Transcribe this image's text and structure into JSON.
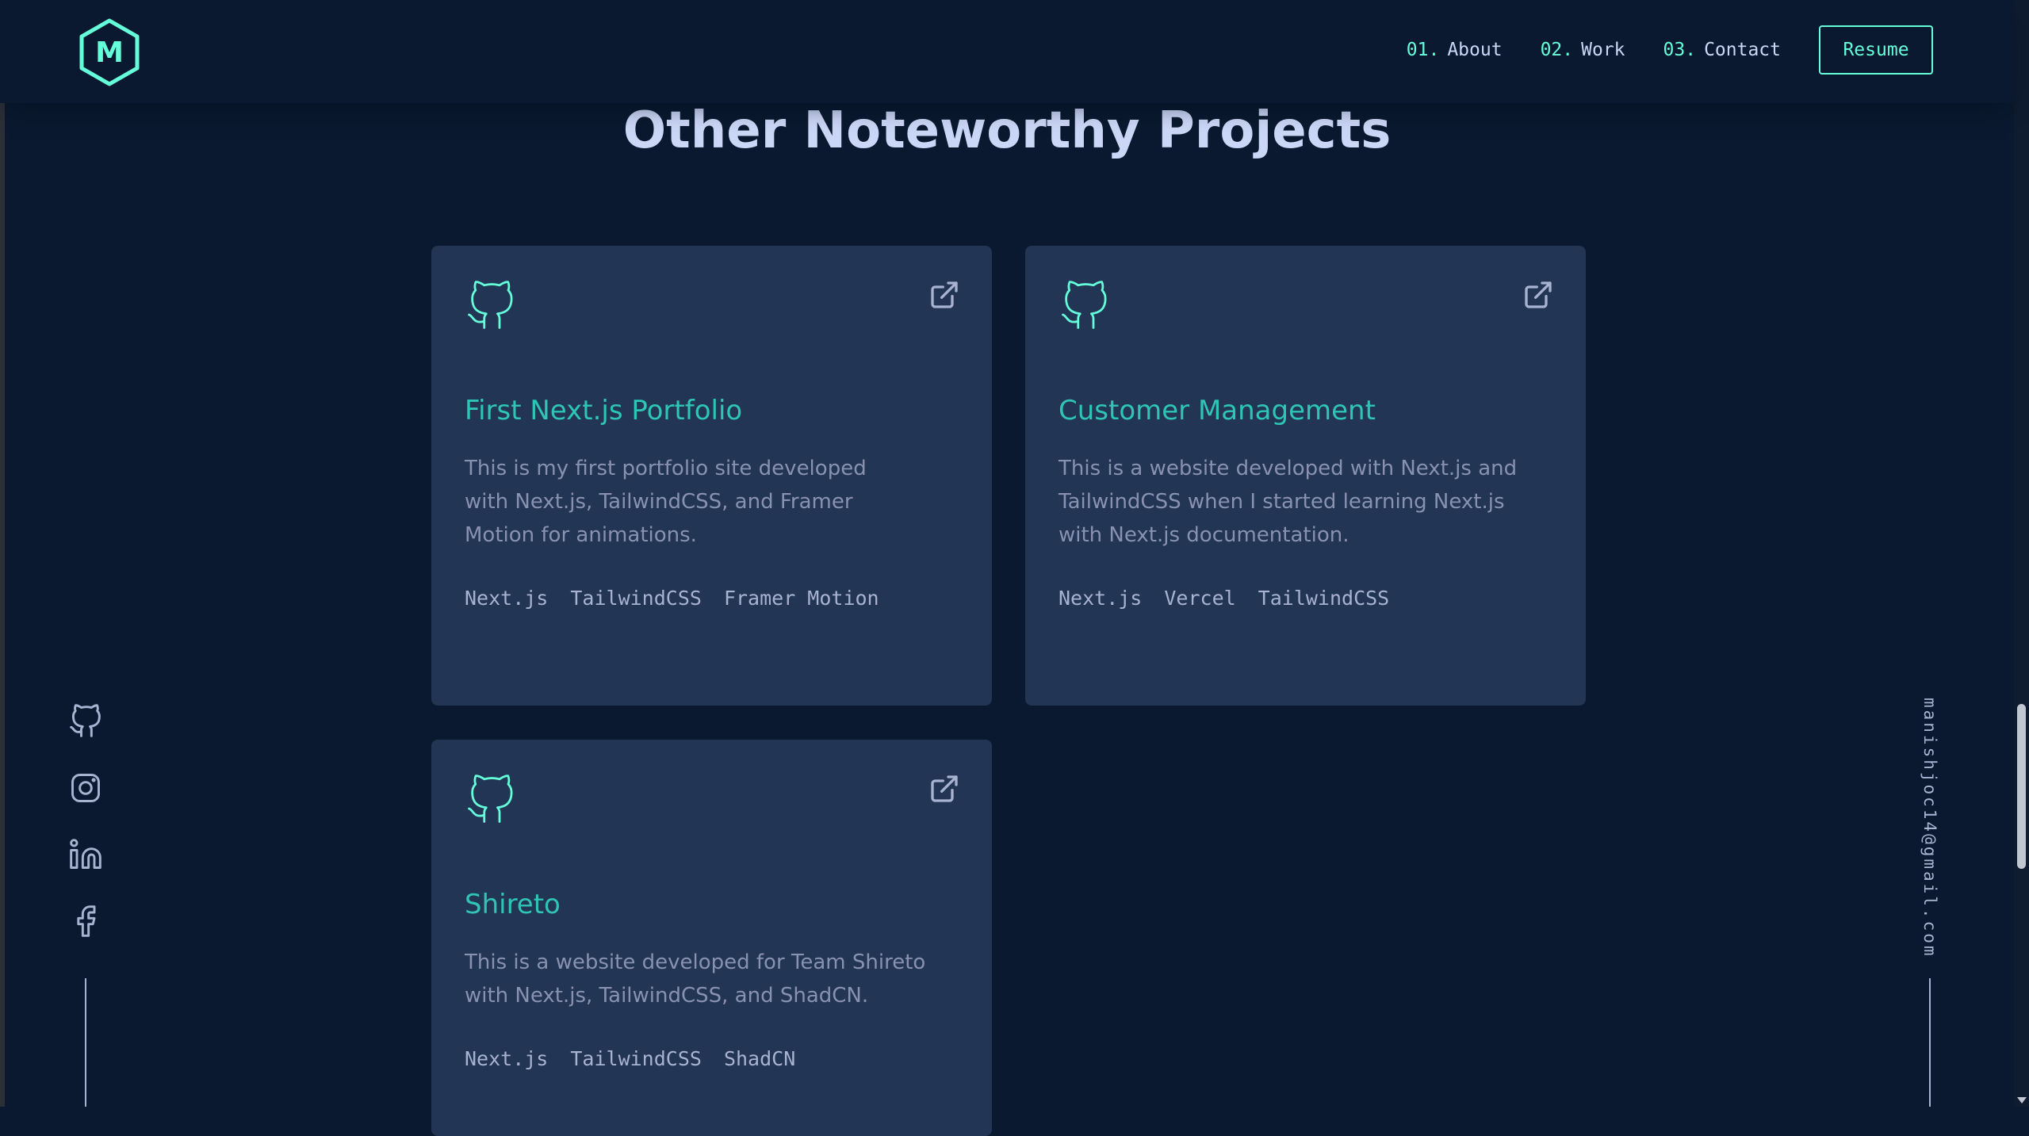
{
  "header": {
    "logo_letter": "M",
    "nav": [
      {
        "num": "01.",
        "label": "About"
      },
      {
        "num": "02.",
        "label": "Work"
      },
      {
        "num": "03.",
        "label": "Contact"
      }
    ],
    "resume_label": "Resume"
  },
  "section_title": "Other Noteworthy Projects",
  "projects": [
    {
      "title": "First Next.js Portfolio",
      "description": "This is my first portfolio site developed with Next.js, TailwindCSS, and Framer Motion for animations.",
      "tech": [
        "Next.js",
        "TailwindCSS",
        "Framer Motion"
      ]
    },
    {
      "title": "Customer Management",
      "description": "This is a website developed with Next.js and TailwindCSS when I started learning Next.js with Next.js documentation.",
      "tech": [
        "Next.js",
        "Vercel",
        "TailwindCSS"
      ]
    },
    {
      "title": "Shireto",
      "description": "This is a website developed for Team Shireto with Next.js, TailwindCSS, and ShadCN.",
      "tech": [
        "Next.js",
        "TailwindCSS",
        "ShadCN"
      ]
    }
  ],
  "socials": [
    "github-icon",
    "instagram-icon",
    "linkedin-icon",
    "facebook-icon"
  ],
  "email": "manishjoc14@gmail.com",
  "colors": {
    "background": "#0a192f",
    "card": "#233554",
    "accent": "#64ffda",
    "title_text": "#2ec4b6",
    "heading": "#ccd6f6",
    "body_text": "#8892b0"
  }
}
